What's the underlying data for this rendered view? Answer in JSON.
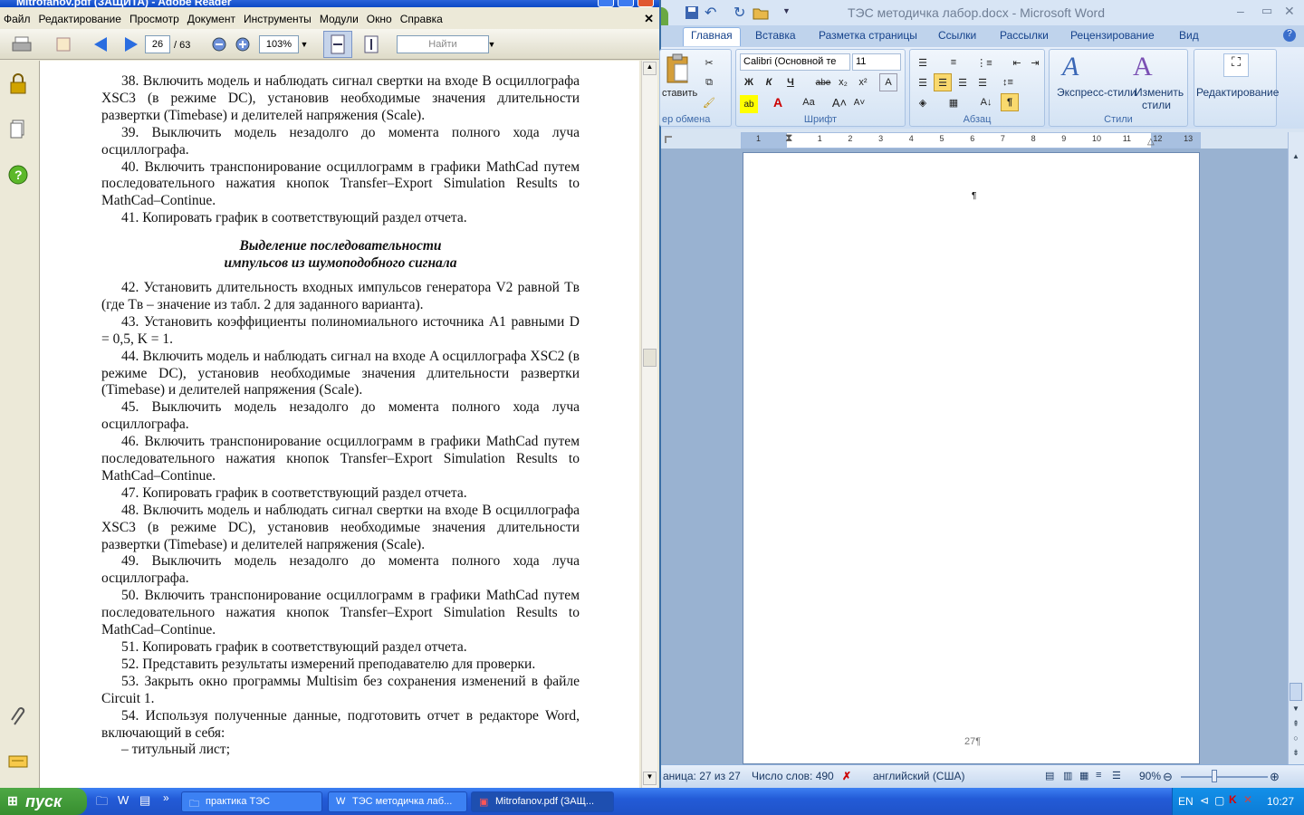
{
  "reader": {
    "title": "Mitrofanov.pdf (ЗАЩИТА) - Adobe Reader",
    "menu": [
      "Файл",
      "Редактирование",
      "Просмотр",
      "Документ",
      "Инструменты",
      "Модули",
      "Окно",
      "Справка"
    ],
    "page_current": "26",
    "page_total": "/ 63",
    "zoom": "103%",
    "search_placeholder": "Найти",
    "content": {
      "p38": "38. Включить модель и наблюдать сигнал свертки на входе B осциллографа XSC3 (в режиме DC), установив необходимые значения длительности развертки (Timebase) и делителей напряжения (Scale).",
      "p39": "39. Выключить модель незадолго до момента полного хода луча осциллографа.",
      "p40": "40. Включить транспонирование осциллограмм в графики MathCad путем последовательного нажатия кнопок Transfer–Export Simulation Results to MathCad–Continue.",
      "p41": "41. Копировать график в соответствующий раздел отчета.",
      "heading1": "Выделение последовательности",
      "heading2": "импульсов из шумоподобного сигнала",
      "p42": "42. Установить длительность входных импульсов генератора V2 равной Tв (где Tв – значение из табл. 2 для заданного варианта).",
      "p43": "43. Установить коэффициенты полиномиального источника A1 равными D = 0,5, K = 1.",
      "p44": "44. Включить модель и наблюдать сигнал на входе A осциллографа XSC2 (в режиме DC), установив необходимые значения длительности развертки (Timebase) и делителей напряжения (Scale).",
      "p45": "45. Выключить модель незадолго до момента полного хода луча осциллографа.",
      "p46": "46. Включить транспонирование осциллограмм в графики MathCad путем последовательного нажатия кнопок Transfer–Export Simulation Results to MathCad–Continue.",
      "p47": "47. Копировать график в соответствующий раздел отчета.",
      "p48": "48. Включить модель и наблюдать сигнал свертки на входе B осциллографа XSC3 (в режиме DC), установив необходимые значения длительности развертки (Timebase) и делителей напряжения (Scale).",
      "p49": "49. Выключить модель незадолго до момента полного хода луча осциллографа.",
      "p50": "50. Включить транспонирование осциллограмм в графики MathCad путем последовательного нажатия кнопок Transfer–Export Simulation Results to MathCad–Continue.",
      "p51": "51. Копировать график в соответствующий раздел отчета.",
      "p52": "52. Представить результаты измерений преподавателю для проверки.",
      "p53": "53. Закрыть окно программы Multisim без сохранения изменений в файле Circuit 1.",
      "p54": "54. Используя полученные данные, подготовить отчет в редакторе Word, включающий в себя:",
      "p55": "– титульный лист;"
    }
  },
  "word": {
    "title": "ТЭС методичка лабор.docx - Microsoft Word",
    "tabs": [
      "Главная",
      "Вставка",
      "Разметка страницы",
      "Ссылки",
      "Рассылки",
      "Рецензирование",
      "Вид"
    ],
    "font_name": "Calibri (Основной те",
    "font_size": "11",
    "paste_label": "ставить",
    "groups": {
      "clipboard": "ер обмена",
      "font": "Шрифт",
      "paragraph": "Абзац",
      "styles": "Стили"
    },
    "express_styles": "Экспресс-стили",
    "change_styles_1": "Изменить",
    "change_styles_2": "стили",
    "editing": "Редактирование",
    "ruler_numbers": [
      "1",
      "1",
      "2",
      "3",
      "4",
      "5",
      "6",
      "7",
      "8",
      "9",
      "10",
      "11",
      "12",
      "13"
    ],
    "pilcrow": "¶",
    "page_number": "27¶",
    "status_page": "аница: 27 из 27",
    "status_words": "Число слов: 490",
    "status_lang": "английский (США)",
    "zoom": "90%"
  },
  "taskbar": {
    "start": "пуск",
    "tasks": [
      "практика ТЭС",
      "ТЭС методичка лаб...",
      "Mitrofanov.pdf (ЗАЩ..."
    ],
    "lang": "EN",
    "time": "10:27"
  },
  "colors": {
    "xp_blue": "#235bd7",
    "start_green": "#378e2f",
    "word_bg": "#d7e4f2"
  }
}
